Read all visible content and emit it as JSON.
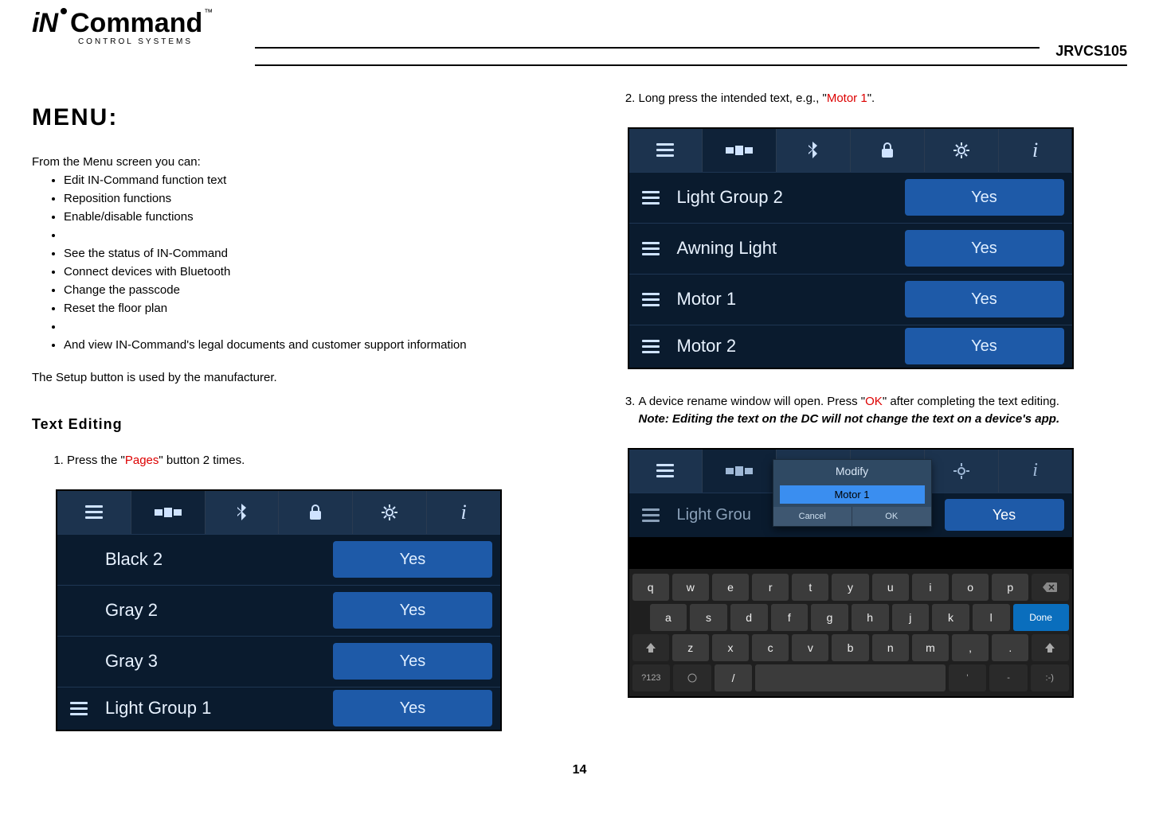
{
  "header": {
    "brand_in": "iN",
    "brand_command": "Command",
    "brand_sub": "CONTROL SYSTEMS",
    "tm": "™",
    "model": "JRVCS105"
  },
  "left": {
    "menu_title": "MENU:",
    "intro": "From the Menu screen you can:",
    "bullets": [
      "Edit IN-Command function text",
      "Reposition functions",
      "Enable/disable functions",
      "",
      "See the status of IN-Command",
      "Connect devices with Bluetooth",
      "Change the passcode",
      "Reset the floor plan",
      "",
      "And view IN-Command's legal documents and customer support information"
    ],
    "setup_note": "The Setup button is used by the manufacturer.",
    "text_editing_heading": "Text Editing",
    "step1_pre": "Press the \"",
    "step1_red": "Pages",
    "step1_post": "\" button 2 times.",
    "shot1": {
      "rows": [
        {
          "drag": false,
          "label": "Black 2",
          "yes": "Yes"
        },
        {
          "drag": false,
          "label": "Gray 2",
          "yes": "Yes"
        },
        {
          "drag": false,
          "label": "Gray 3",
          "yes": "Yes"
        },
        {
          "drag": true,
          "label": "Light Group 1",
          "yes": "Yes"
        }
      ]
    }
  },
  "right": {
    "step2_pre": "Long press the intended text, e.g., \"",
    "step2_red": "Motor 1",
    "step2_post": "\".",
    "shot2": {
      "rows": [
        {
          "drag": true,
          "label": "Light Group 2",
          "yes": "Yes"
        },
        {
          "drag": true,
          "label": "Awning Light",
          "yes": "Yes"
        },
        {
          "drag": true,
          "label": "Motor 1",
          "yes": "Yes"
        },
        {
          "drag": true,
          "label": "Motor 2",
          "yes": "Yes"
        }
      ]
    },
    "step3_pre": "A device rename window will open. Press \"",
    "step3_red": "OK",
    "step3_post": "\" after completing the text editing.",
    "step3_note": "Note: Editing the text on the DC will not change the text on a device's app.",
    "shot3": {
      "bg_row_label": "Light Grou",
      "bg_yes": "Yes",
      "modal_title": "Modify",
      "modal_value": "Motor 1",
      "modal_cancel": "Cancel",
      "modal_ok": "OK",
      "keys_r1": [
        "q",
        "w",
        "e",
        "r",
        "t",
        "y",
        "u",
        "i",
        "o",
        "p"
      ],
      "keys_r2": [
        "a",
        "s",
        "d",
        "f",
        "g",
        "h",
        "j",
        "k",
        "l"
      ],
      "done": "Done",
      "keys_r3": [
        "z",
        "x",
        "c",
        "v",
        "b",
        "n",
        "m",
        ",",
        "."
      ],
      "sym": "?123",
      "slash": "/"
    }
  },
  "page_number": "14"
}
